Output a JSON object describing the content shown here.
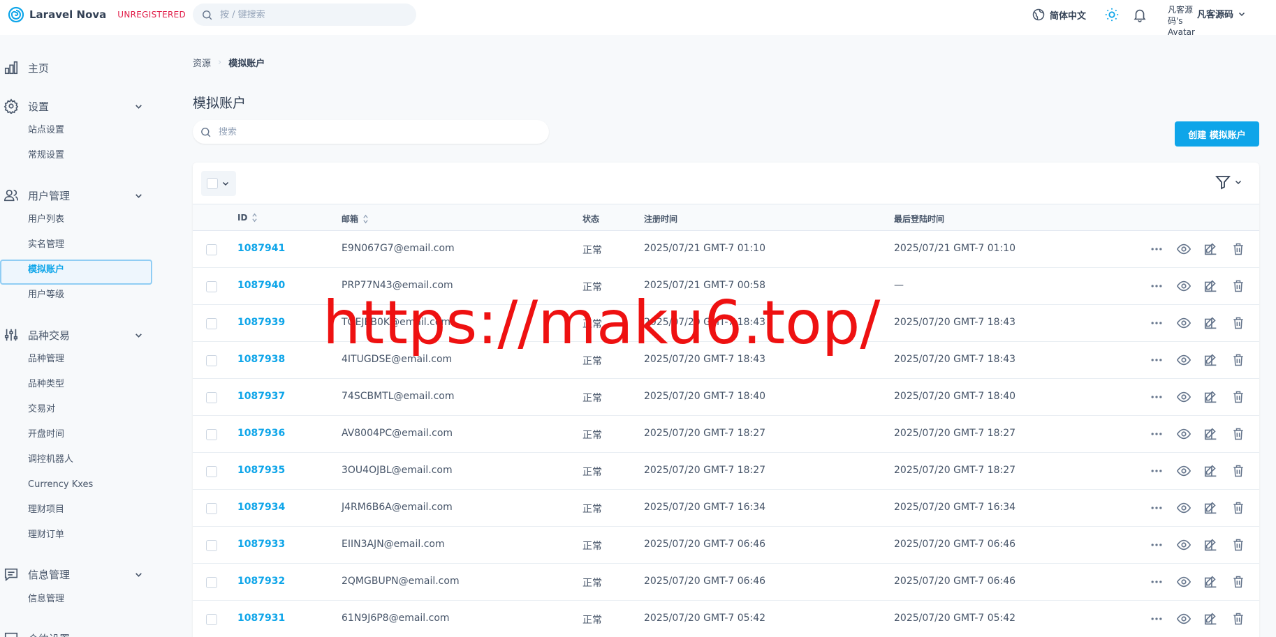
{
  "app": {
    "brand": "Laravel Nova",
    "badge": "UNREGISTERED"
  },
  "global_search": {
    "placeholder": "按 / 键搜索"
  },
  "header": {
    "language": "简体中文",
    "avatar_alt": "凡客源码's Avatar",
    "user_name": "凡客源码"
  },
  "sidebar": {
    "home": "主页",
    "groups": [
      {
        "label": "设置",
        "items": [
          "站点设置",
          "常规设置"
        ]
      },
      {
        "label": "用户管理",
        "items": [
          "用户列表",
          "实名管理",
          "模拟账户",
          "用户等级"
        ]
      },
      {
        "label": "品种交易",
        "items": [
          "品种管理",
          "品种类型",
          "交易对",
          "开盘时间",
          "调控机器人",
          "Currency Kxes",
          "理财项目",
          "理财订单"
        ]
      },
      {
        "label": "信息管理",
        "items": [
          "信息管理"
        ]
      },
      {
        "label": "合約设置",
        "items": []
      }
    ]
  },
  "breadcrumb": {
    "root": "资源",
    "current": "模拟账户"
  },
  "page": {
    "title": "模拟账户",
    "search_placeholder": "搜索",
    "create_label": "创建 模拟账户"
  },
  "table": {
    "columns": [
      "ID",
      "邮箱",
      "状态",
      "注册时间",
      "最后登陆时间"
    ],
    "rows": [
      {
        "id": "1087941",
        "email": "E9N067G7@email.com",
        "status": "正常",
        "registered": "2025/07/21 GMT-7 01:10",
        "last_login": "2025/07/21 GMT-7 01:10"
      },
      {
        "id": "1087940",
        "email": "PRP77N43@email.com",
        "status": "正常",
        "registered": "2025/07/21 GMT-7 00:58",
        "last_login": "—"
      },
      {
        "id": "1087939",
        "email": "TOEJEB0K@email.com",
        "status": "正常",
        "registered": "2025/07/20 GMT-7 18:43",
        "last_login": "2025/07/20 GMT-7 18:43"
      },
      {
        "id": "1087938",
        "email": "4ITUGDSE@email.com",
        "status": "正常",
        "registered": "2025/07/20 GMT-7 18:43",
        "last_login": "2025/07/20 GMT-7 18:43"
      },
      {
        "id": "1087937",
        "email": "74SCBMTL@email.com",
        "status": "正常",
        "registered": "2025/07/20 GMT-7 18:40",
        "last_login": "2025/07/20 GMT-7 18:40"
      },
      {
        "id": "1087936",
        "email": "AV8004PC@email.com",
        "status": "正常",
        "registered": "2025/07/20 GMT-7 18:27",
        "last_login": "2025/07/20 GMT-7 18:27"
      },
      {
        "id": "1087935",
        "email": "3OU4OJBL@email.com",
        "status": "正常",
        "registered": "2025/07/20 GMT-7 18:27",
        "last_login": "2025/07/20 GMT-7 18:27"
      },
      {
        "id": "1087934",
        "email": "J4RM6B6A@email.com",
        "status": "正常",
        "registered": "2025/07/20 GMT-7 16:34",
        "last_login": "2025/07/20 GMT-7 16:34"
      },
      {
        "id": "1087933",
        "email": "EIIN3AJN@email.com",
        "status": "正常",
        "registered": "2025/07/20 GMT-7 06:46",
        "last_login": "2025/07/20 GMT-7 06:46"
      },
      {
        "id": "1087932",
        "email": "2QMGBUPN@email.com",
        "status": "正常",
        "registered": "2025/07/20 GMT-7 06:46",
        "last_login": "2025/07/20 GMT-7 06:46"
      },
      {
        "id": "1087931",
        "email": "61N9J6P8@email.com",
        "status": "正常",
        "registered": "2025/07/20 GMT-7 05:42",
        "last_login": "2025/07/20 GMT-7 05:42"
      }
    ]
  },
  "watermark": "https://maku6.top/",
  "colors": {
    "accent": "#0ea5e9",
    "badge": "#e11d48",
    "watermark": "#ee1111"
  }
}
